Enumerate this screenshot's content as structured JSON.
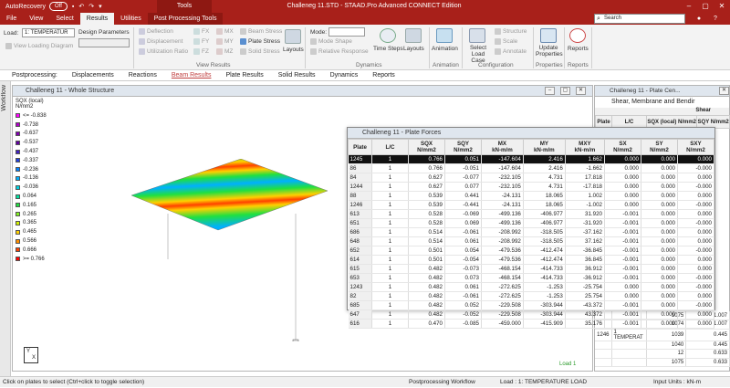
{
  "title_bar": {
    "autorecovery": "AutoRecovery",
    "toggle": "Off",
    "tools_context": "Tools",
    "app_title": "Challeneg 11.STD - STAAD.Pro Advanced CONNECT Edition"
  },
  "tabs": [
    "File",
    "View",
    "Select",
    "Results",
    "Utilities",
    "Post Processing Tools"
  ],
  "search_placeholder": "Search",
  "ribbon": {
    "load_label": "Load:",
    "load_value": "1: TEMPERATUR",
    "design_params_label": "Design Parameters",
    "view_loading_diagram": "View Loading Diagram",
    "deflection": "Deflection",
    "displacement": "Displacement",
    "utilization_ratio": "Utilization Ratio",
    "fx": "FX",
    "fy": "FY",
    "fz": "FZ",
    "mx": "MX",
    "my": "MY",
    "mz": "MZ",
    "beam_stress": "Beam Stress",
    "plate_stress": "Plate Stress",
    "solid_stress": "Solid Stress",
    "layouts1": "Layouts",
    "view_results_group": "View Results",
    "mode_label": "Mode:",
    "mode_shape": "Mode Shape",
    "relative_response": "Relative Response",
    "time_steps": "Time Steps",
    "layouts2": "Layouts",
    "dynamics_group": "Dynamics",
    "animation": "Animation",
    "animation_group": "Animation",
    "select_load_case": "Select Load Case",
    "structure": "Structure",
    "scale": "Scale",
    "annotate": "Annotate",
    "configuration_group": "Configuration",
    "update_properties": "Update Properties",
    "properties_group": "Properties",
    "reports": "Reports",
    "reports_group": "Reports"
  },
  "pp_label": "Postprocessing:",
  "pp_tabs": [
    "Displacements",
    "Reactions",
    "Beam Results",
    "Plate Results",
    "Solid Results",
    "Dynamics",
    "Reports"
  ],
  "workflow_label": "Workflow",
  "main_window": {
    "title": "Challeneg 11 - Whole Structure",
    "load_label": "Load 1"
  },
  "legend": {
    "title": "SQX (local)",
    "unit": "N/mm2",
    "items": [
      {
        "label": "<= -0.838",
        "color": "#ff00ff"
      },
      {
        "label": "-0.738",
        "color": "#b000c8"
      },
      {
        "label": "-0.637",
        "color": "#8000b0"
      },
      {
        "label": "-0.537",
        "color": "#6000a0"
      },
      {
        "label": "-0.437",
        "color": "#4020c0"
      },
      {
        "label": "-0.337",
        "color": "#2040e0"
      },
      {
        "label": "-0.236",
        "color": "#0080ff"
      },
      {
        "label": "-0.136",
        "color": "#00b0ff"
      },
      {
        "label": "-0.036",
        "color": "#00d0e0"
      },
      {
        "label": "0.064",
        "color": "#00e0a0"
      },
      {
        "label": "0.165",
        "color": "#20e040"
      },
      {
        "label": "0.265",
        "color": "#80f020"
      },
      {
        "label": "0.365",
        "color": "#d0f000"
      },
      {
        "label": "0.465",
        "color": "#ffd000"
      },
      {
        "label": "0.566",
        "color": "#ff9000"
      },
      {
        "label": "0.666",
        "color": "#ff4000"
      },
      {
        "label": ">= 0.766",
        "color": "#ff0000"
      }
    ]
  },
  "right_window": {
    "title": "Challeneg 11 - Plate Cen...",
    "section": "Shear, Membrane and Bendir",
    "shear_label": "Shear",
    "headers": [
      "Plate",
      "L/C",
      "SQX (local) N/mm2",
      "SQY N/mm2"
    ],
    "bottom_rows": [
      [
        "",
        "",
        "1075",
        "1.007"
      ],
      [
        "",
        "",
        "1074",
        "1.007"
      ],
      [
        "1246",
        "1 TEMPERAT",
        "1039",
        "0.445"
      ],
      [
        "",
        "",
        "1040",
        "0.445"
      ],
      [
        "",
        "",
        "12",
        "0.633"
      ],
      [
        "",
        "",
        "1075",
        "0.633"
      ]
    ]
  },
  "plate_forces": {
    "title": "Challeneg 11 - Plate Forces",
    "headers": [
      "Plate",
      "L/C",
      "SQX N/mm2",
      "SQY N/mm2",
      "MX kN-m/m",
      "MY kN-m/m",
      "MXY kN-m/m",
      "SX N/mm2",
      "SY N/mm2",
      "SXY N/mm2"
    ],
    "rows": [
      [
        "1245",
        "1",
        "0.766",
        "0.051",
        "-147.604",
        "2.416",
        "1.662",
        "0.000",
        "0.000",
        "0.000"
      ],
      [
        "86",
        "1",
        "0.766",
        "-0.051",
        "-147.604",
        "2.416",
        "-1.662",
        "0.000",
        "0.000",
        "-0.000"
      ],
      [
        "84",
        "1",
        "0.627",
        "-0.077",
        "-232.105",
        "4.731",
        "17.818",
        "0.000",
        "0.000",
        "0.000"
      ],
      [
        "1244",
        "1",
        "0.627",
        "0.077",
        "-232.105",
        "4.731",
        "-17.818",
        "0.000",
        "0.000",
        "-0.000"
      ],
      [
        "88",
        "1",
        "0.539",
        "0.441",
        "-24.131",
        "18.065",
        "1.002",
        "0.000",
        "0.000",
        "0.000"
      ],
      [
        "1246",
        "1",
        "0.539",
        "-0.441",
        "-24.131",
        "18.065",
        "-1.002",
        "0.000",
        "0.000",
        "-0.000"
      ],
      [
        "613",
        "1",
        "0.528",
        "-0.069",
        "-499.136",
        "-406.977",
        "31.920",
        "-0.001",
        "0.000",
        "0.000"
      ],
      [
        "651",
        "1",
        "0.528",
        "0.069",
        "-499.136",
        "-406.977",
        "-31.920",
        "-0.001",
        "0.000",
        "-0.000"
      ],
      [
        "686",
        "1",
        "0.514",
        "-0.061",
        "-208.992",
        "-318.505",
        "-37.162",
        "-0.001",
        "0.000",
        "0.000"
      ],
      [
        "648",
        "1",
        "0.514",
        "0.061",
        "-208.992",
        "-318.505",
        "37.162",
        "-0.001",
        "0.000",
        "0.000"
      ],
      [
        "652",
        "1",
        "0.501",
        "0.054",
        "-479.536",
        "-412.474",
        "-36.845",
        "-0.001",
        "0.000",
        "-0.000"
      ],
      [
        "614",
        "1",
        "0.501",
        "-0.054",
        "-479.536",
        "-412.474",
        "36.845",
        "-0.001",
        "0.000",
        "0.000"
      ],
      [
        "615",
        "1",
        "0.482",
        "-0.073",
        "-468.154",
        "-414.733",
        "36.912",
        "-0.001",
        "0.000",
        "0.000"
      ],
      [
        "653",
        "1",
        "0.482",
        "0.073",
        "-468.154",
        "-414.733",
        "-36.912",
        "-0.001",
        "0.000",
        "-0.000"
      ],
      [
        "1243",
        "1",
        "0.482",
        "0.061",
        "-272.625",
        "-1.253",
        "-25.754",
        "0.000",
        "0.000",
        "-0.000"
      ],
      [
        "82",
        "1",
        "0.482",
        "-0.061",
        "-272.625",
        "-1.253",
        "25.754",
        "0.000",
        "0.000",
        "0.000"
      ],
      [
        "685",
        "1",
        "0.482",
        "0.052",
        "-229.508",
        "-303.944",
        "-43.372",
        "-0.001",
        "0.000",
        "-0.000"
      ],
      [
        "647",
        "1",
        "0.482",
        "-0.052",
        "-229.508",
        "-303.944",
        "43.372",
        "-0.001",
        "0.000",
        "0.000"
      ],
      [
        "616",
        "1",
        "0.470",
        "-0.085",
        "-459.000",
        "-415.909",
        "35.176",
        "-0.001",
        "0.000",
        "0.000"
      ]
    ]
  },
  "status": {
    "hint": "Click on plates to select (Ctrl+click to toggle selection)",
    "workflow": "Postprocessing Workflow",
    "load": "Load : 1: TEMPERATURE LOAD",
    "units": "Input Units : kN-m"
  }
}
